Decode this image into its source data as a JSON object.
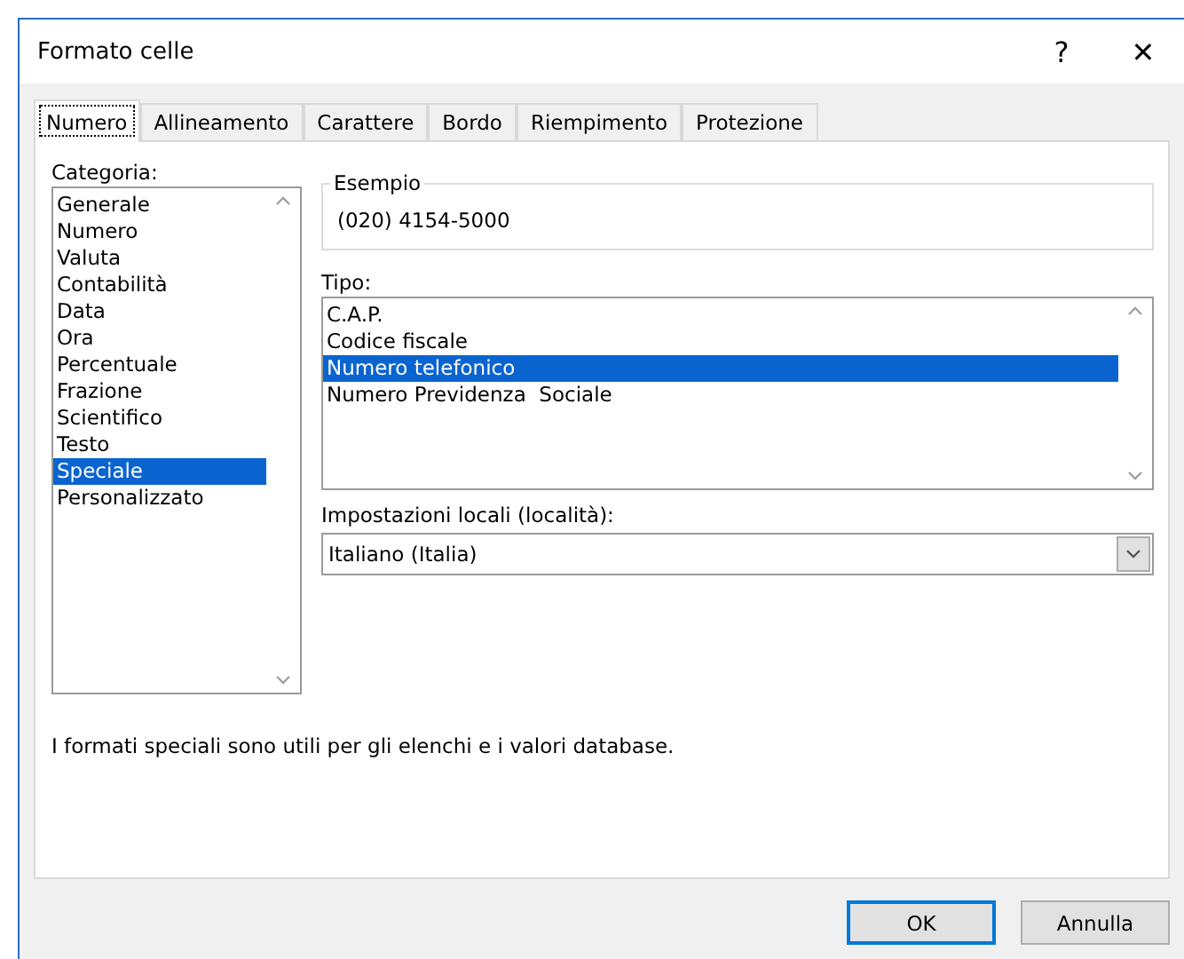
{
  "window": {
    "title": "Formato celle",
    "help": "?",
    "close": "✕"
  },
  "tabs": [
    {
      "label": "Numero",
      "selected": true
    },
    {
      "label": "Allineamento",
      "selected": false
    },
    {
      "label": "Carattere",
      "selected": false
    },
    {
      "label": "Bordo",
      "selected": false
    },
    {
      "label": "Riempimento",
      "selected": false
    },
    {
      "label": "Protezione",
      "selected": false
    }
  ],
  "category": {
    "label": "Categoria:",
    "items": [
      {
        "label": "Generale",
        "selected": false
      },
      {
        "label": "Numero",
        "selected": false
      },
      {
        "label": "Valuta",
        "selected": false
      },
      {
        "label": "Contabilità",
        "selected": false
      },
      {
        "label": "Data",
        "selected": false
      },
      {
        "label": "Ora",
        "selected": false
      },
      {
        "label": "Percentuale",
        "selected": false
      },
      {
        "label": "Frazione",
        "selected": false
      },
      {
        "label": "Scientifico",
        "selected": false
      },
      {
        "label": "Testo",
        "selected": false
      },
      {
        "label": "Speciale",
        "selected": true
      },
      {
        "label": "Personalizzato",
        "selected": false
      }
    ]
  },
  "sample": {
    "label": "Esempio",
    "value": "(020) 4154-5000"
  },
  "type": {
    "label": "Tipo:",
    "items": [
      {
        "label": "C.A.P.",
        "selected": false
      },
      {
        "label": "Codice fiscale",
        "selected": false
      },
      {
        "label": "Numero telefonico",
        "selected": true
      },
      {
        "label": "Numero Previdenza  Sociale",
        "selected": false
      }
    ]
  },
  "locale": {
    "label": "Impostazioni locali (località):",
    "value": "Italiano (Italia)"
  },
  "description": "I formati speciali sono utili per gli elenchi e i valori database.",
  "buttons": [
    {
      "label": "OK",
      "default": true
    },
    {
      "label": "Annulla",
      "default": false
    }
  ]
}
